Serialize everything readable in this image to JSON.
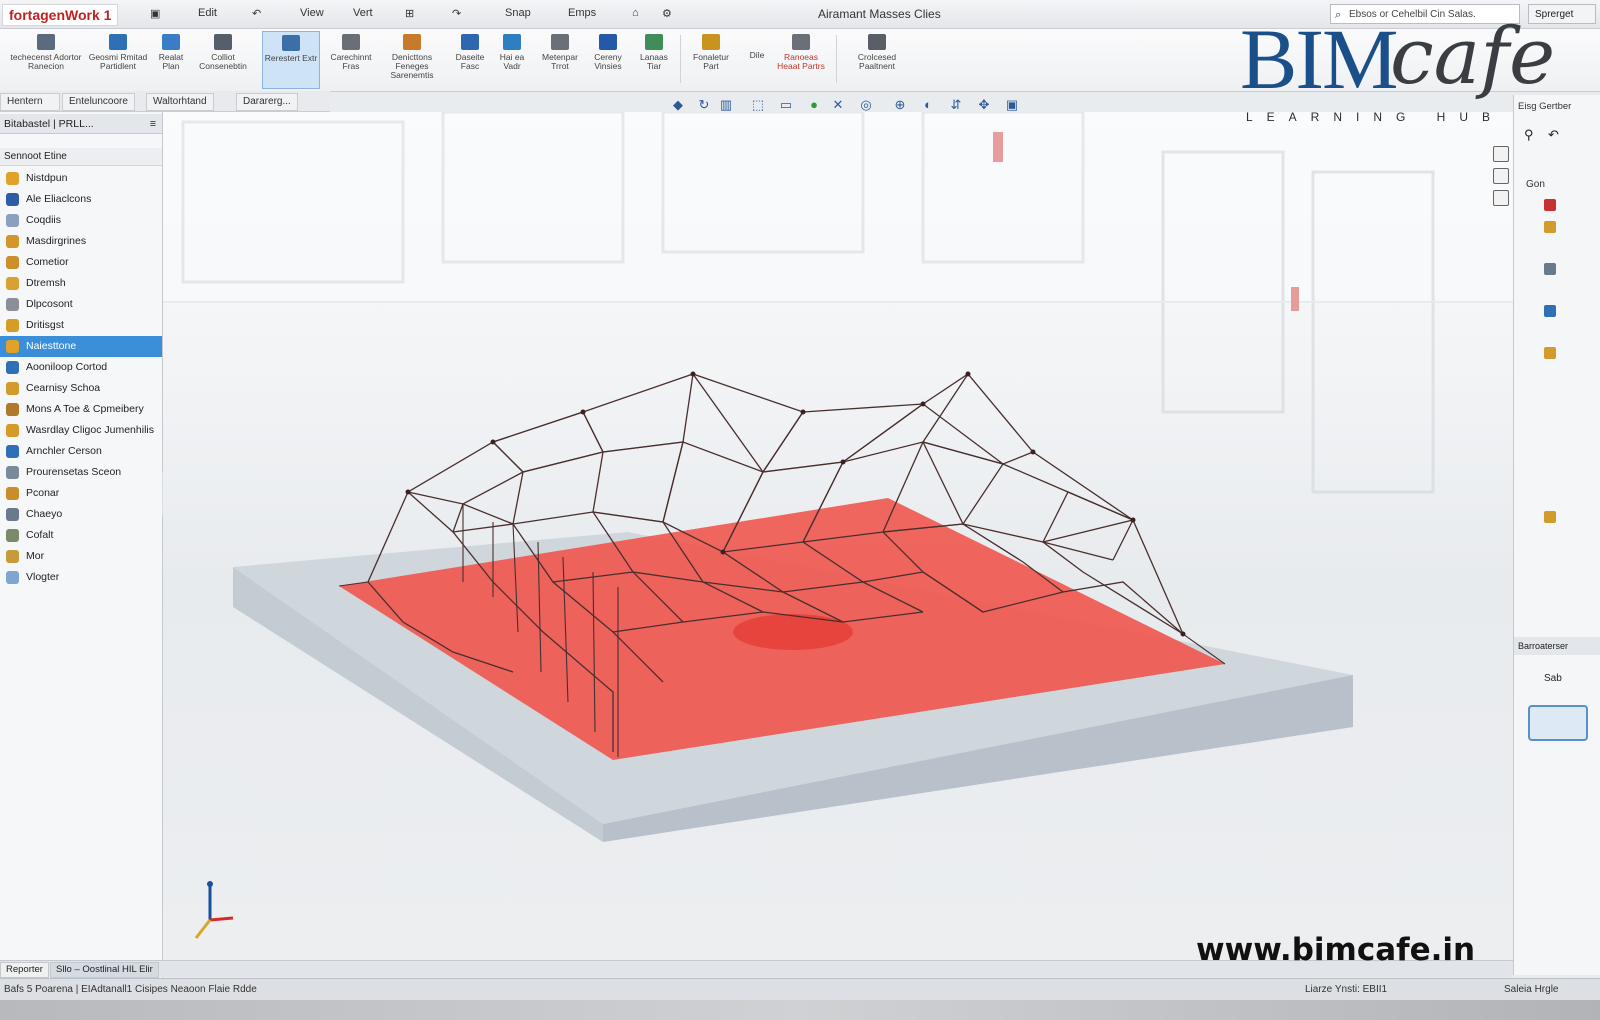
{
  "titlebar": {
    "app_name": "fortagenWork 1",
    "quick_access": [
      "Edit",
      "View",
      "Vert",
      "Snap",
      "Emps"
    ],
    "window_title": "Airamant Masses Clies",
    "search_placeholder": "Ebsos or Cehelbil Cin Salas.",
    "signin_label": "Sprerget"
  },
  "ribbon": {
    "buttons": [
      {
        "label": "techecenst Adortor Ranecion",
        "icon": "wrench-icon",
        "color": "#5b6b7e"
      },
      {
        "label": "Geosmi Rmitad Partidlent",
        "icon": "house-icon",
        "color": "#2f6fb5"
      },
      {
        "label": "Realat Plan",
        "icon": "grid-icon",
        "color": "#3c7cc4"
      },
      {
        "label": "Colliot Consenebtin",
        "icon": "shape-icon",
        "color": "#555f6b"
      },
      {
        "label": "Rerestert Extr",
        "icon": "box-icon",
        "color": "#3a6fa8"
      },
      {
        "label": "Carechinnt Fras",
        "icon": "sheet-icon",
        "color": "#6a6f77"
      },
      {
        "label": "Denicttons Feneges Sarenemtis",
        "icon": "layers-icon",
        "color": "#c77a2a"
      },
      {
        "label": "Daseite Fasc",
        "icon": "chart-icon",
        "color": "#2f66b0"
      },
      {
        "label": "Hai ea Vadr",
        "icon": "person-icon",
        "color": "#2d7fc1"
      },
      {
        "label": "Metenpar Trrot",
        "icon": "sketch-icon",
        "color": "#6a7078"
      },
      {
        "label": "Cereny Vinsies",
        "icon": "table-icon",
        "color": "#2459a8"
      },
      {
        "label": "Lanaas Tiar",
        "icon": "globe-icon",
        "color": "#3f8e5a"
      },
      {
        "label": "Fonaletur Part",
        "icon": "brick-icon",
        "color": "#c9931f"
      },
      {
        "label": "Dile",
        "icon": "",
        "color": "#888888"
      },
      {
        "label": "Ranoeas Heaat Partrs",
        "icon": "frame-icon",
        "color": "#6b7078"
      },
      {
        "label": "Crolcesed Paaltnent",
        "icon": "print-icon",
        "color": "#5a5f67"
      }
    ]
  },
  "doc_tabs": [
    "Hentern",
    "Enteluncoore",
    "Waltorhtand",
    "Dararerg..."
  ],
  "left_panel": {
    "header": "Bitabastel | PRLL...",
    "section": "Sennoot Etine",
    "items": [
      {
        "label": "Nistdpun",
        "color": "#e2a22a"
      },
      {
        "label": "Ale Eliaclcons",
        "color": "#2f5ca6"
      },
      {
        "label": "Coqdiis",
        "color": "#8aa0c0"
      },
      {
        "label": "Masdirgrines",
        "color": "#d3962b"
      },
      {
        "label": "Cometior",
        "color": "#cc8f2a"
      },
      {
        "label": "Dtremsh",
        "color": "#d8a232"
      },
      {
        "label": "Dlpcosont",
        "color": "#8a8f98"
      },
      {
        "label": "Dritisgst",
        "color": "#d59d28"
      },
      {
        "label": "Naiesttone",
        "color": "#e2a22a",
        "selected": true
      },
      {
        "label": "Aooniloop Cortod",
        "color": "#2f6fb5"
      },
      {
        "label": "Cearnisy Schoa",
        "color": "#d39a2c"
      },
      {
        "label": "Mons A Toe & Cpmeibery",
        "color": "#b07a2a"
      },
      {
        "label": "Wasrdlay Cligoc Jumenhilis",
        "color": "#d49b2b"
      },
      {
        "label": "Arnchler Cerson",
        "color": "#2f6fb5"
      },
      {
        "label": "Prourensetas Sceon",
        "color": "#7a8a9a"
      },
      {
        "label": "Pconar",
        "color": "#c98d2a"
      },
      {
        "label": "Chaeyo",
        "color": "#6a7a8c"
      },
      {
        "label": "Cofalt",
        "color": "#7a8a6a"
      },
      {
        "label": "Mor",
        "color": "#c79a3a"
      },
      {
        "label": "Vlogter",
        "color": "#7fa6d0"
      }
    ]
  },
  "right_panel": {
    "header": "Eisg Gertber",
    "tree_root": "Gon",
    "props_header": "Barroaterser",
    "card_label": "Sab"
  },
  "viewport": {
    "model": "red-floor-slab-with-wireframe-roof",
    "accent_red": "#f0564e"
  },
  "bottom_tabs": [
    "Reporter",
    "Sllo – Oostlinal HIL Elir"
  ],
  "statusbar": {
    "left": "Bafs 5 Poarena | EIAdtanall1 Cisipes Neaoon Flaie Rdde",
    "middle": "Liarze Ynsti: EBII1",
    "right": "Saleia Hrgle"
  },
  "logo": {
    "bim": "BIM",
    "cafe": "cafe",
    "tagline": "LEARNING HUB"
  },
  "watermark": "www.bimcafe.in"
}
